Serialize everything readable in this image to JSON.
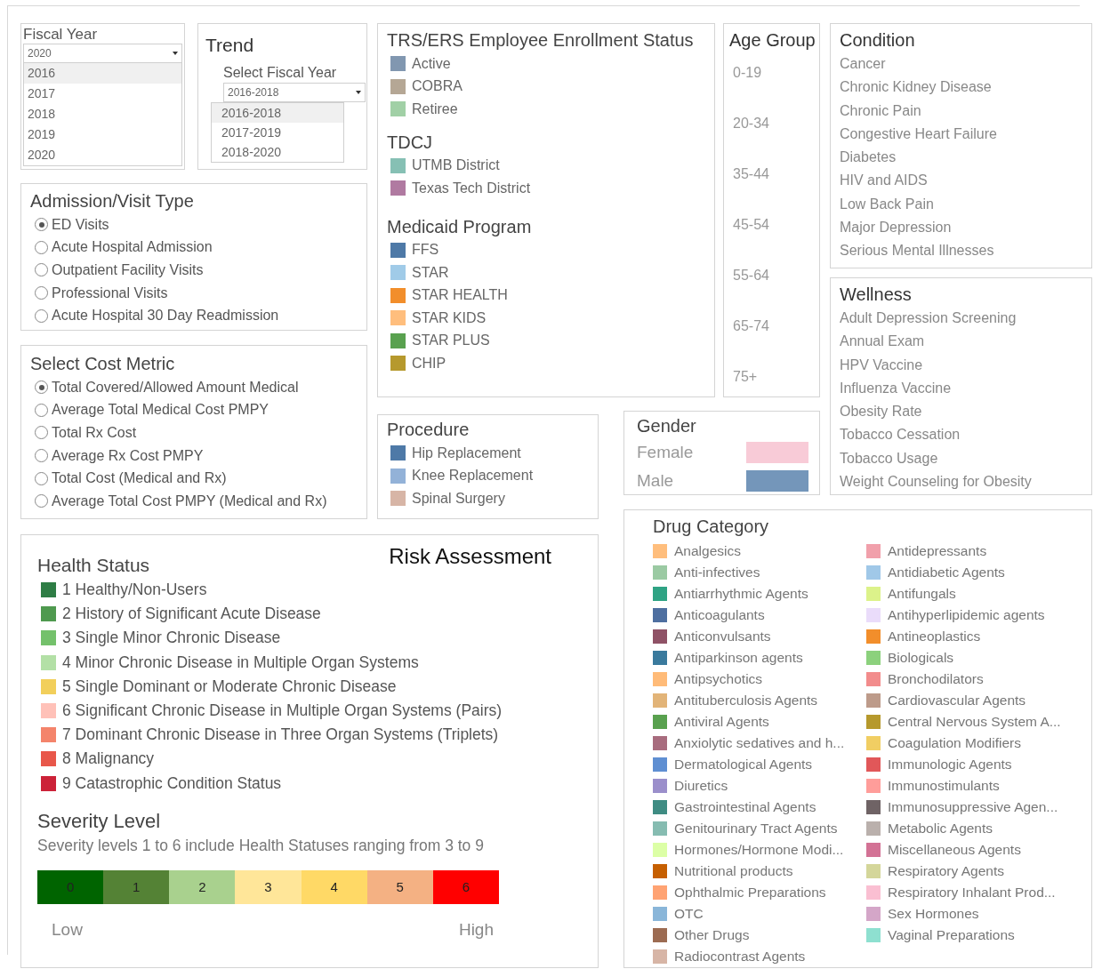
{
  "fiscal_year": {
    "title": "Fiscal Year",
    "value": "2020",
    "options": [
      {
        "label": "2016",
        "highlighted": true
      },
      {
        "label": "2017",
        "highlighted": false
      },
      {
        "label": "2018",
        "highlighted": false
      },
      {
        "label": "2019",
        "highlighted": false
      },
      {
        "label": "2020",
        "highlighted": false
      }
    ]
  },
  "trend": {
    "title": "Trend",
    "label": "Select Fiscal Year",
    "value": "2016-2018",
    "options": [
      {
        "label": "2016-2018",
        "highlighted": true
      },
      {
        "label": "2017-2019",
        "highlighted": false
      },
      {
        "label": "2018-2020",
        "highlighted": false
      }
    ]
  },
  "admission_visit_type": {
    "title": "Admission/Visit Type",
    "options": [
      {
        "label": "ED Visits",
        "selected": true
      },
      {
        "label": "Acute Hospital Admission",
        "selected": false
      },
      {
        "label": "Outpatient Facility Visits",
        "selected": false
      },
      {
        "label": "Professional Visits",
        "selected": false
      },
      {
        "label": "Acute Hospital 30 Day Readmission",
        "selected": false
      }
    ]
  },
  "cost_metric": {
    "title": "Select Cost Metric",
    "options": [
      {
        "label": "Total Covered/Allowed Amount Medical",
        "selected": true
      },
      {
        "label": "Average Total Medical Cost PMPY",
        "selected": false
      },
      {
        "label": "Total Rx Cost",
        "selected": false
      },
      {
        "label": "Average Rx Cost PMPY",
        "selected": false
      },
      {
        "label": "Total Cost (Medical and Rx)",
        "selected": false
      },
      {
        "label": "Average Total Cost PMPY (Medical and Rx)",
        "selected": false
      }
    ]
  },
  "enrollment": {
    "sections": [
      {
        "heading": "TRS/ERS Employee Enrollment Status",
        "items": [
          {
            "label": "Active",
            "color": "#8197b0"
          },
          {
            "label": "COBRA",
            "color": "#b5a795"
          },
          {
            "label": "Retiree",
            "color": "#a1d0a6"
          }
        ]
      },
      {
        "heading": "TDCJ",
        "items": [
          {
            "label": "UTMB District",
            "color": "#86c0b4"
          },
          {
            "label": "Texas Tech District",
            "color": "#b07aa1"
          }
        ]
      },
      {
        "heading": "Medicaid Program",
        "items": [
          {
            "label": "FFS",
            "color": "#4e79a7"
          },
          {
            "label": "STAR",
            "color": "#a0cbe8"
          },
          {
            "label": "STAR HEALTH",
            "color": "#f28e2b"
          },
          {
            "label": "STAR KIDS",
            "color": "#ffbe7d"
          },
          {
            "label": "STAR PLUS",
            "color": "#59a14f"
          },
          {
            "label": "CHIP",
            "color": "#b6992d"
          }
        ]
      }
    ]
  },
  "age_group": {
    "title": "Age Group",
    "items": [
      "0-19",
      "20-34",
      "35-44",
      "45-54",
      "55-64",
      "65-74",
      "75+"
    ]
  },
  "condition": {
    "title": "Condition",
    "items": [
      "Cancer",
      "Chronic Kidney Disease",
      "Chronic Pain",
      "Congestive Heart Failure",
      "Diabetes",
      "HIV and AIDS",
      "Low Back Pain",
      "Major Depression",
      "Serious Mental Illnesses"
    ]
  },
  "wellness": {
    "title": "Wellness",
    "items": [
      "Adult Depression Screening",
      "Annual Exam",
      "HPV Vaccine",
      "Influenza Vaccine",
      "Obesity Rate",
      "Tobacco Cessation",
      "Tobacco Usage",
      "Weight Counseling for Obesity"
    ]
  },
  "procedure": {
    "title": "Procedure",
    "items": [
      {
        "label": "Hip Replacement",
        "color": "#4e79a7"
      },
      {
        "label": "Knee Replacement",
        "color": "#93b2d8"
      },
      {
        "label": "Spinal Surgery",
        "color": "#d7b5a6"
      }
    ]
  },
  "gender": {
    "title": "Gender",
    "items": [
      {
        "label": "Female",
        "color": "#f8cbd7"
      },
      {
        "label": "Male",
        "color": "#7496ba"
      }
    ]
  },
  "drug_category": {
    "title": "Drug Category",
    "items": [
      {
        "label": "Analgesics",
        "color": "#ffbe7d"
      },
      {
        "label": "Anti-infectives",
        "color": "#9bcaa3"
      },
      {
        "label": "Antiarrhythmic Agents",
        "color": "#2fa384"
      },
      {
        "label": "Anticoagulants",
        "color": "#4e6fa0"
      },
      {
        "label": "Anticonvulsants",
        "color": "#8f5266"
      },
      {
        "label": "Antiparkinson agents",
        "color": "#3a7a9d"
      },
      {
        "label": "Antipsychotics",
        "color": "#ffbb78"
      },
      {
        "label": "Antituberculosis Agents",
        "color": "#e2b478"
      },
      {
        "label": "Antiviral Agents",
        "color": "#59a14f"
      },
      {
        "label": "Anxiolytic sedatives and h...",
        "color": "#a86c7e"
      },
      {
        "label": "Dermatological Agents",
        "color": "#5f8fd2"
      },
      {
        "label": "Diuretics",
        "color": "#9b8fcb"
      },
      {
        "label": "Gastrointestinal Agents",
        "color": "#3f8c83"
      },
      {
        "label": "Genitourinary Tract Agents",
        "color": "#86bcb1"
      },
      {
        "label": "Hormones/Hormone Modi...",
        "color": "#dcffa6"
      },
      {
        "label": "Nutritional products",
        "color": "#c65f00"
      },
      {
        "label": "Ophthalmic Preparations",
        "color": "#ffa373"
      },
      {
        "label": "OTC",
        "color": "#8ab6d9"
      },
      {
        "label": "Other Drugs",
        "color": "#9c6b52"
      },
      {
        "label": "Radiocontrast Agents",
        "color": "#d7b5a6"
      },
      {
        "label": "Antidepressants",
        "color": "#f1a0ab"
      },
      {
        "label": "Antidiabetic Agents",
        "color": "#a0c8e8"
      },
      {
        "label": "Antifungals",
        "color": "#dcf28a"
      },
      {
        "label": "Antihyperlipidemic agents",
        "color": "#eadcfa"
      },
      {
        "label": "Antineoplastics",
        "color": "#f28e2b"
      },
      {
        "label": "Biologicals",
        "color": "#8cd17d"
      },
      {
        "label": "Bronchodilators",
        "color": "#f28c8c"
      },
      {
        "label": "Cardiovascular Agents",
        "color": "#bd9b8a"
      },
      {
        "label": "Central Nervous System A...",
        "color": "#b6992d"
      },
      {
        "label": "Coagulation Modifiers",
        "color": "#f1ce63"
      },
      {
        "label": "Immunologic Agents",
        "color": "#e15759"
      },
      {
        "label": "Immunostimulants",
        "color": "#ff9d9a"
      },
      {
        "label": "Immunosuppressive Agen...",
        "color": "#6f6365"
      },
      {
        "label": "Metabolic Agents",
        "color": "#bab0ac"
      },
      {
        "label": "Miscellaneous Agents",
        "color": "#d37295"
      },
      {
        "label": "Respiratory Agents",
        "color": "#d4d69a"
      },
      {
        "label": "Respiratory Inhalant Prod...",
        "color": "#fabfd2"
      },
      {
        "label": "Sex Hormones",
        "color": "#d4a6c8"
      },
      {
        "label": "Vaginal Preparations",
        "color": "#8ee0d0"
      }
    ]
  },
  "risk_assessment": {
    "title": "Risk Assessment",
    "health_status": {
      "title": "Health Status",
      "items": [
        {
          "label": "1 Healthy/Non-Users",
          "color": "#2e7d45"
        },
        {
          "label": "2 History of Significant Acute Disease",
          "color": "#4f9a4f"
        },
        {
          "label": "3 Single Minor Chronic Disease",
          "color": "#74c16b"
        },
        {
          "label": "4 Minor Chronic Disease in Multiple Organ Systems",
          "color": "#b3e0a6"
        },
        {
          "label": "5 Single Dominant or Moderate Chronic Disease",
          "color": "#f2cf5b"
        },
        {
          "label": "6 Significant Chronic Disease in Multiple Organ Systems (Pairs)",
          "color": "#ffc1b8"
        },
        {
          "label": "7 Dominant Chronic Disease in Three Organ Systems (Triplets)",
          "color": "#f4846b"
        },
        {
          "label": "8 Malignancy",
          "color": "#e8574a"
        },
        {
          "label": "9 Catastrophic Condition Status",
          "color": "#cc2238"
        }
      ]
    },
    "severity": {
      "title": "Severity Level",
      "description": "Severity levels 1 to 6 include Health Statuses ranging from 3 to 9",
      "levels": [
        {
          "label": "0",
          "color": "#006400"
        },
        {
          "label": "1",
          "color": "#548235"
        },
        {
          "label": "2",
          "color": "#a9d18e"
        },
        {
          "label": "3",
          "color": "#ffe699"
        },
        {
          "label": "4",
          "color": "#ffd966"
        },
        {
          "label": "5",
          "color": "#f4b183"
        },
        {
          "label": "6",
          "color": "#ff0000"
        }
      ],
      "low_label": "Low",
      "high_label": "High"
    }
  }
}
